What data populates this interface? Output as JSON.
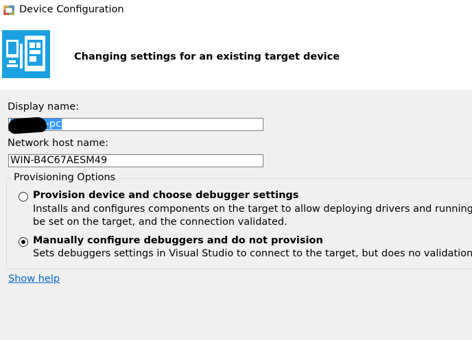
{
  "window": {
    "title": "Device Configuration"
  },
  "header": {
    "heading": "Changing settings for an existing target device",
    "accent_color": "#1ba1e2"
  },
  "display_name": {
    "label": "Display name:",
    "value": "-pc"
  },
  "host_name": {
    "label": "Network host name:",
    "value": "WIN-B4C67AESM49"
  },
  "provisioning": {
    "legend": "Provisioning Options",
    "options": [
      {
        "title": "Provision device and choose debugger settings",
        "desc1": "Installs and configures components on the target to allow deploying drivers and running",
        "desc2": "be set on the target, and the connection validated.",
        "selected": false
      },
      {
        "title": "Manually configure debuggers and do not provision",
        "desc1": "Sets debuggers settings in Visual Studio to connect to the target, but does no validation o",
        "selected": true
      }
    ]
  },
  "help_link": "Show help"
}
